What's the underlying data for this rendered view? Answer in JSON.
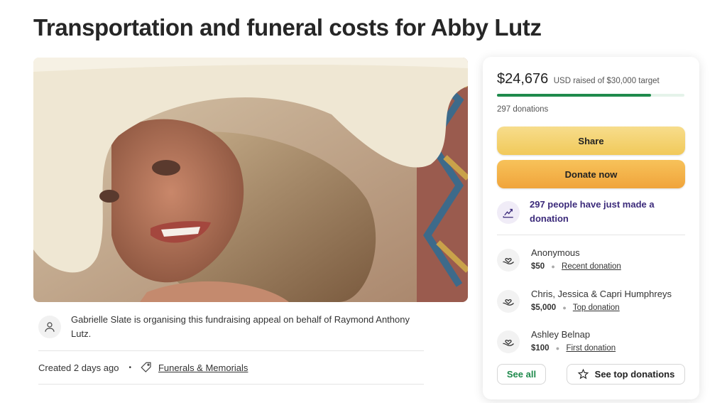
{
  "page": {
    "title": "Transportation and funeral costs for Abby Lutz"
  },
  "hero": {
    "image": "fundraiser-photo"
  },
  "organiser": {
    "text": "Gabrielle Slate is organising this fundraising appeal on behalf of Raymond Anthony Lutz.",
    "icon": "user-icon"
  },
  "meta": {
    "created": "Created 2 days ago",
    "dot": "•",
    "category": "Funerals & Memorials",
    "icon": "tag-icon"
  },
  "card": {
    "amount": "$24,676",
    "target_text": "USD raised of $30,000 target",
    "progress_fraction": 0.8225,
    "donations": "297 donations",
    "share_label": "Share",
    "donate_label": "Donate now",
    "trend_text": "297 people have just made a donation",
    "donors": [
      {
        "name": "Anonymous",
        "amount": "$50",
        "type": "Recent donation"
      },
      {
        "name": "Chris, Jessica & Capri Humphreys",
        "amount": "$5,000",
        "type": "Top donation"
      },
      {
        "name": "Ashley Belnap",
        "amount": "$100",
        "type": "First donation"
      }
    ],
    "see_all_label": "See all",
    "see_top_label": "See top donations"
  },
  "colors": {
    "accent_green": "#1f8a4c",
    "share_yellow": "#f1c95a",
    "donate_orange": "#f0a43b",
    "trend_purple": "#3b2a7a"
  }
}
